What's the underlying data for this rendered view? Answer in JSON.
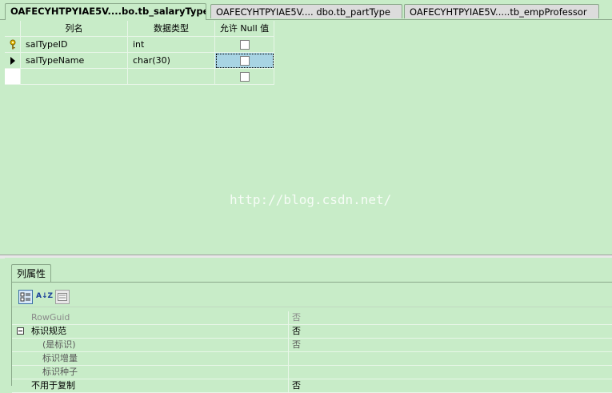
{
  "tabs": [
    {
      "label": "OAFECYHTPYIAE5V....bo.tb_salaryType",
      "active": true
    },
    {
      "label": "OAFECYHTPYIAE5V.... dbo.tb_partType",
      "active": false
    },
    {
      "label": "OAFECYHTPYIAE5V.....tb_empProfessor",
      "active": false
    }
  ],
  "grid": {
    "headers": {
      "name": "列名",
      "type": "数据类型",
      "nullable": "允许 Null 值"
    },
    "rows": [
      {
        "name": "salTypeID",
        "type": "int",
        "indicator": "key-icon",
        "nullable": false
      },
      {
        "name": "salTypeName",
        "type": "char(30)",
        "indicator": "current-row-arrow-icon",
        "nullable": false
      },
      {
        "name": "",
        "type": "",
        "indicator": "",
        "nullable": false
      }
    ]
  },
  "watermark": "http://blog.csdn.net/",
  "properties": {
    "tab_label": "列属性",
    "toolbar": {
      "categorized": "categorized-icon",
      "alphabetical": "A↓Z",
      "pages": "property-pages-icon"
    },
    "rows": [
      {
        "name": "RowGuid",
        "value": "否"
      },
      {
        "name": "标识规范",
        "value": "否"
      },
      {
        "name": "(是标识)",
        "value": "否"
      },
      {
        "name": "标识增量",
        "value": ""
      },
      {
        "name": "标识种子",
        "value": ""
      },
      {
        "name": "不用于复制",
        "value": "否"
      }
    ]
  }
}
